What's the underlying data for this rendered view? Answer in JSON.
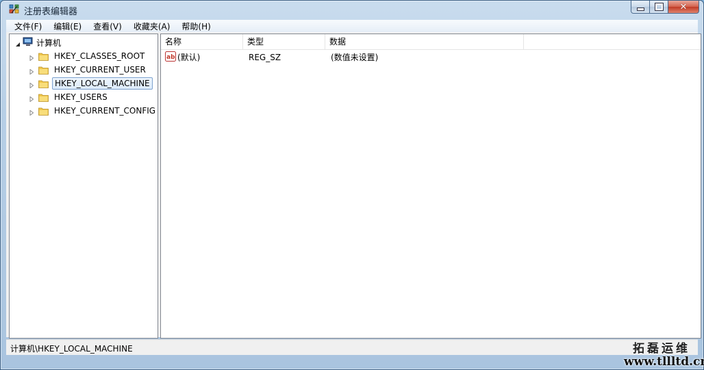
{
  "window": {
    "title": "注册表编辑器"
  },
  "menu": [
    "文件(F)",
    "编辑(E)",
    "查看(V)",
    "收藏夹(A)",
    "帮助(H)"
  ],
  "tree": {
    "root": "计算机",
    "items": [
      {
        "label": "HKEY_CLASSES_ROOT",
        "selected": false
      },
      {
        "label": "HKEY_CURRENT_USER",
        "selected": false
      },
      {
        "label": "HKEY_LOCAL_MACHINE",
        "selected": true
      },
      {
        "label": "HKEY_USERS",
        "selected": false
      },
      {
        "label": "HKEY_CURRENT_CONFIG",
        "selected": false
      }
    ]
  },
  "list": {
    "columns": [
      "名称",
      "类型",
      "数据"
    ],
    "rows": [
      {
        "icon": "string-value-icon",
        "name": "(默认)",
        "type": "REG_SZ",
        "data": "(数值未设置)"
      }
    ]
  },
  "status": {
    "path": "计算机\\HKEY_LOCAL_MACHINE"
  },
  "watermark": {
    "name": "拓磊运维",
    "url": "www.tllltd.cn"
  },
  "colors": {
    "folder": "#f0c64a",
    "selection_border": "#7da2ce",
    "close_button": "#c8402b"
  }
}
